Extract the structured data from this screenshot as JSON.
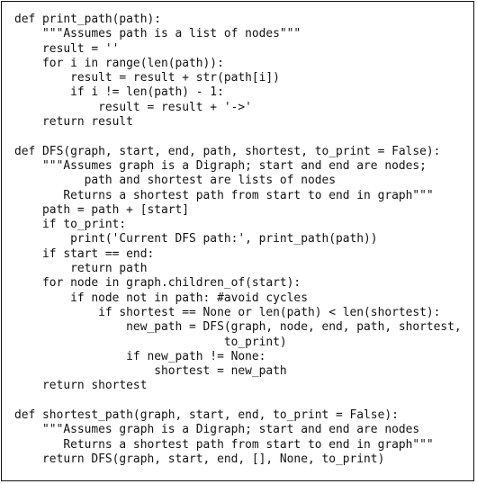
{
  "code": {
    "lines": [
      "def print_path(path):",
      "    \"\"\"Assumes path is a list of nodes\"\"\"",
      "    result = ''",
      "    for i in range(len(path)):",
      "        result = result + str(path[i])",
      "        if i != len(path) - 1:",
      "            result = result + '->'",
      "    return result",
      "",
      "def DFS(graph, start, end, path, shortest, to_print = False):",
      "    \"\"\"Assumes graph is a Digraph; start and end are nodes;",
      "          path and shortest are lists of nodes",
      "       Returns a shortest path from start to end in graph\"\"\"",
      "    path = path + [start]",
      "    if to_print:",
      "        print('Current DFS path:', print_path(path))",
      "    if start == end:",
      "        return path",
      "    for node in graph.children_of(start):",
      "        if node not in path: #avoid cycles",
      "            if shortest == None or len(path) < len(shortest):",
      "                new_path = DFS(graph, node, end, path, shortest,",
      "                              to_print)",
      "                if new_path != None:",
      "                    shortest = new_path",
      "    return shortest",
      "",
      "def shortest_path(graph, start, end, to_print = False):",
      "    \"\"\"Assumes graph is a Digraph; start and end are nodes",
      "       Returns a shortest path from start to end in graph\"\"\"",
      "    return DFS(graph, start, end, [], None, to_print)"
    ]
  }
}
